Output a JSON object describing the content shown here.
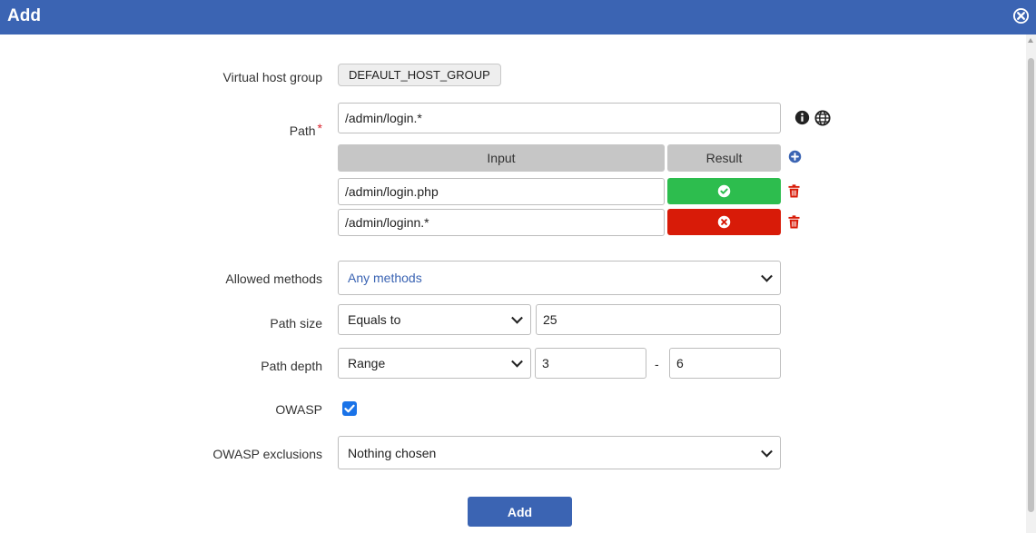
{
  "dialog": {
    "title": "Add"
  },
  "form": {
    "virtual_host_group": {
      "label": "Virtual host group",
      "value": "DEFAULT_HOST_GROUP"
    },
    "path": {
      "label": "Path",
      "required_marker": "*",
      "value": "/admin/login.*",
      "test_table": {
        "input_header": "Input",
        "result_header": "Result",
        "rows": [
          {
            "input": "/admin/login.php",
            "result": "match",
            "color": "#2dbd4e"
          },
          {
            "input": "/admin/loginn.*",
            "result": "no-match",
            "color": "#d81b08"
          }
        ]
      }
    },
    "allowed_methods": {
      "label": "Allowed methods",
      "value": "Any methods"
    },
    "path_size": {
      "label": "Path size",
      "operator": "Equals to",
      "value": "25"
    },
    "path_depth": {
      "label": "Path depth",
      "operator": "Range",
      "min": "3",
      "separator": "-",
      "max": "6"
    },
    "owasp": {
      "label": "OWASP",
      "checked": true
    },
    "owasp_exclusions": {
      "label": "OWASP exclusions",
      "value": "Nothing chosen"
    },
    "submit_label": "Add"
  },
  "colors": {
    "accent": "#3b64b3",
    "success": "#2dbd4e",
    "danger": "#d81b08",
    "checkbox": "#1a73e8"
  }
}
